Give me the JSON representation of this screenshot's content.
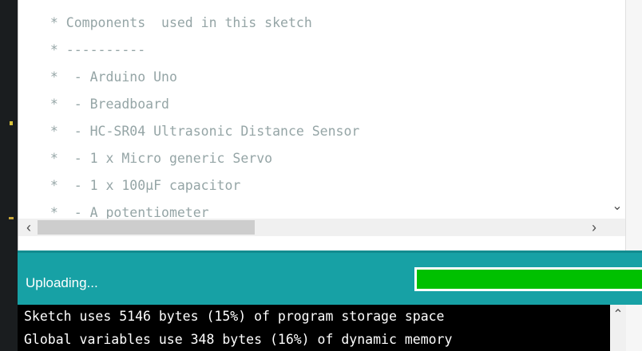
{
  "editor": {
    "lines": [
      " * Components  used in this sketch",
      " * ----------",
      " *  - Arduino Uno",
      " *  - Breadboard",
      " *  - HC-SR04 Ultrasonic Distance Sensor",
      " *  - 1 x Micro generic Servo",
      " *  - 1 x 100µF capacitor",
      " *  - A potentiometer"
    ],
    "scroll_icons": {
      "down": "chevron-down-icon",
      "left": "chevron-left-icon",
      "right": "chevron-right-icon"
    }
  },
  "status": {
    "text": "Uploading...",
    "progress": 1.0,
    "colors": {
      "bar": "#17a1a5",
      "progress": "#00c000"
    }
  },
  "console": {
    "lines": [
      "Sketch uses 5146 bytes (15%) of program storage space",
      "Global variables use 348 bytes (16%) of dynamic memory"
    ],
    "scroll_icon": "chevron-up-icon"
  }
}
